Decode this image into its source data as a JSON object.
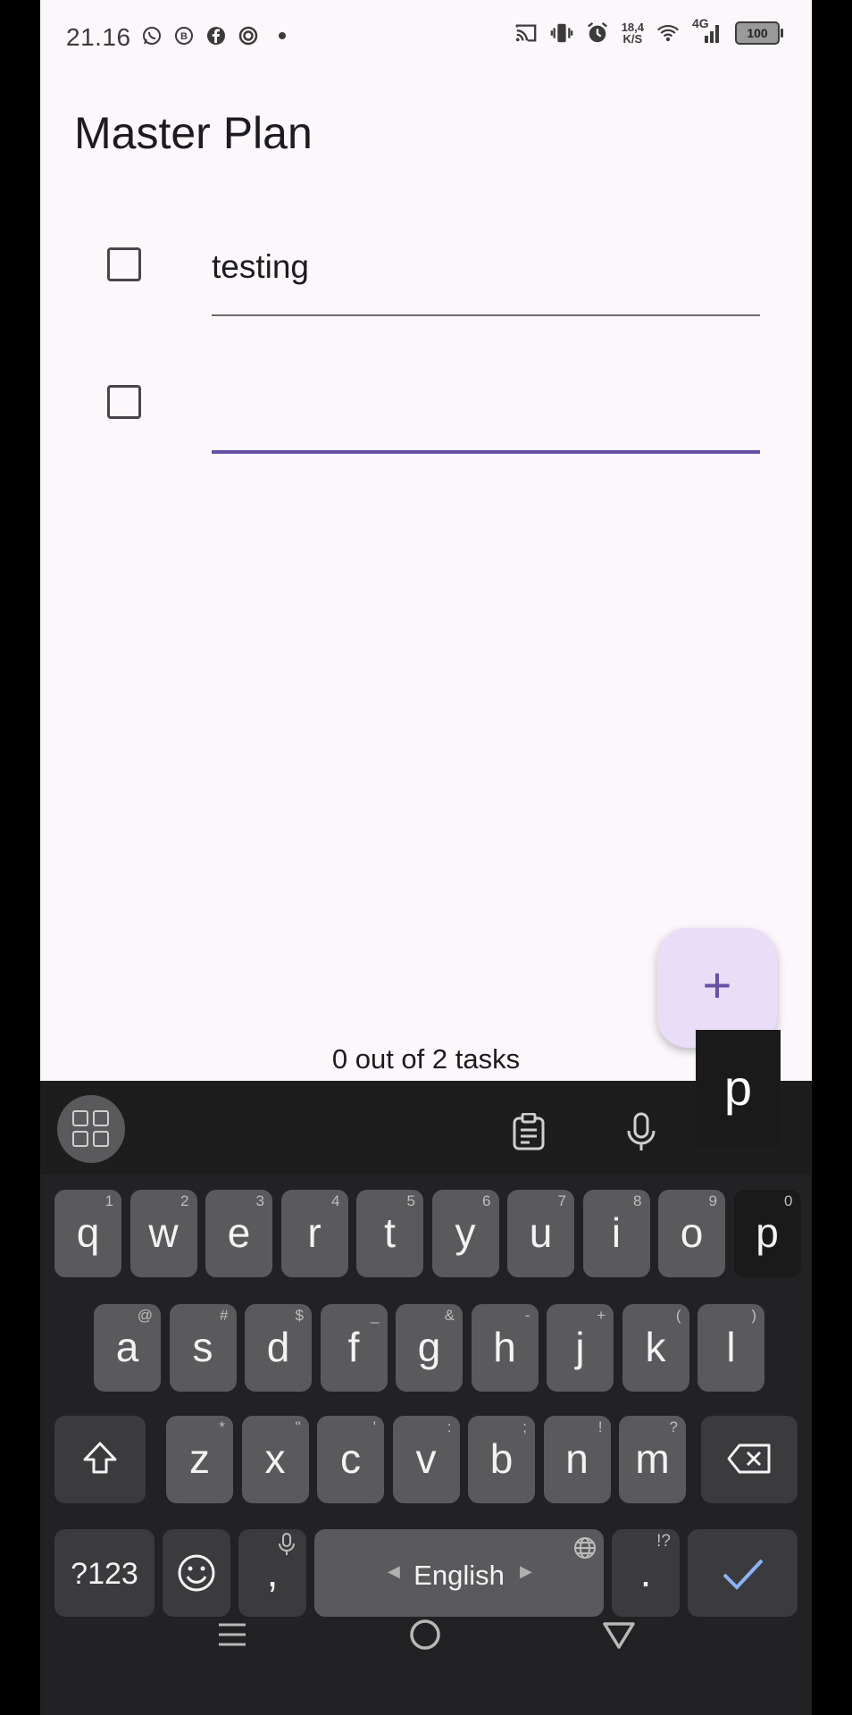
{
  "status_bar": {
    "time": "21.16",
    "speed_value": "18,4",
    "speed_unit": "K/S",
    "network": "4G",
    "battery": "100"
  },
  "app": {
    "title": "Master Plan",
    "tasks": [
      {
        "text": "testing",
        "checked": false
      },
      {
        "text": "",
        "checked": false
      }
    ],
    "fab_label": "+",
    "summary": "0 out of 2 tasks",
    "accent_color": "#6750a4"
  },
  "keyboard": {
    "popup_letter": "p",
    "row1": [
      {
        "k": "q",
        "h": "1"
      },
      {
        "k": "w",
        "h": "2"
      },
      {
        "k": "e",
        "h": "3"
      },
      {
        "k": "r",
        "h": "4"
      },
      {
        "k": "t",
        "h": "5"
      },
      {
        "k": "y",
        "h": "6"
      },
      {
        "k": "u",
        "h": "7"
      },
      {
        "k": "i",
        "h": "8"
      },
      {
        "k": "o",
        "h": "9"
      },
      {
        "k": "p",
        "h": "0"
      }
    ],
    "row2": [
      {
        "k": "a",
        "h": "@"
      },
      {
        "k": "s",
        "h": "#"
      },
      {
        "k": "d",
        "h": "$"
      },
      {
        "k": "f",
        "h": "_"
      },
      {
        "k": "g",
        "h": "&"
      },
      {
        "k": "h",
        "h": "-"
      },
      {
        "k": "j",
        "h": "+"
      },
      {
        "k": "k",
        "h": "("
      },
      {
        "k": "l",
        "h": ")"
      }
    ],
    "row3": [
      {
        "k": "z",
        "h": "*"
      },
      {
        "k": "x",
        "h": "\""
      },
      {
        "k": "c",
        "h": "'"
      },
      {
        "k": "v",
        "h": ":"
      },
      {
        "k": "b",
        "h": ";"
      },
      {
        "k": "n",
        "h": "!"
      },
      {
        "k": "m",
        "h": "?"
      }
    ],
    "symbols_label": "?123",
    "comma": ",",
    "space_label": "English",
    "period": ".",
    "period_hint": "!?"
  }
}
